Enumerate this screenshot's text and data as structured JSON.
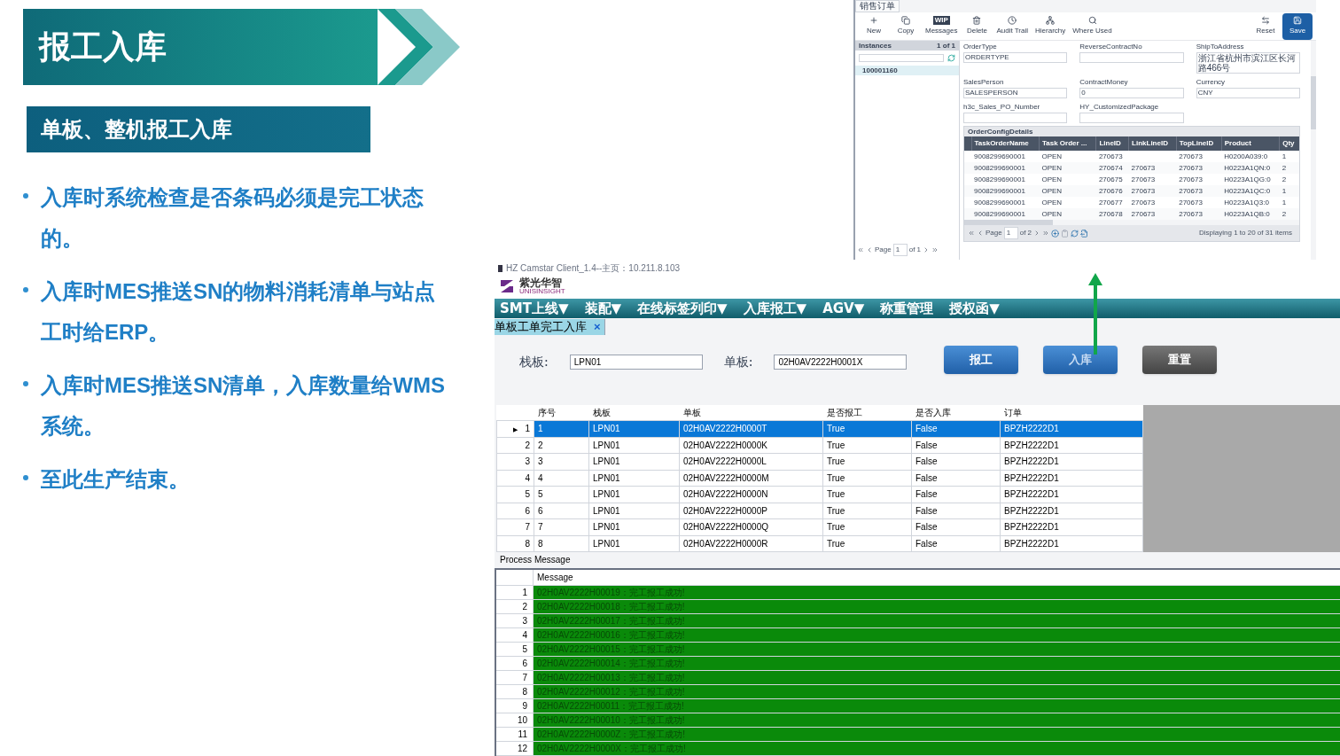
{
  "slide": {
    "title": "报工入库",
    "subtitle": "单板、整机报工入库",
    "bullets": [
      "入库时系统检查是否条码必须是完工状态的。",
      "入库时MES推送SN的物料消耗清单与站点工时给ERP。",
      "入库时MES推送SN清单，入库数量给WMS系统。",
      "至此生产结束。"
    ]
  },
  "sales_order_window": {
    "tab": "销售订单",
    "toolbar": [
      {
        "kind": "new",
        "label": "New"
      },
      {
        "kind": "copy",
        "label": "Copy"
      },
      {
        "kind": "wip",
        "label": "Messages",
        "badge": "WIP"
      },
      {
        "kind": "delete",
        "label": "Delete"
      },
      {
        "kind": "audit",
        "label": "Audit Trail"
      },
      {
        "kind": "hierarchy",
        "label": "Hierarchy"
      },
      {
        "kind": "where",
        "label": "Where Used"
      },
      {
        "kind": "reset",
        "label": "Reset"
      },
      {
        "kind": "save",
        "label": "Save"
      }
    ],
    "instances": {
      "title": "Instances",
      "count": "1 of 1",
      "items": [
        {
          "label": "100001160",
          "selected": true
        }
      ],
      "pager": {
        "page": "Page",
        "value": "1",
        "of": "of 1"
      }
    },
    "fields": [
      {
        "label": "OrderType",
        "value": "ORDERTYPE"
      },
      {
        "label": "ReverseContractNo"
      },
      {
        "label": "ShipToAddress",
        "value": "浙江省杭州市滨江区长河路466号"
      },
      {
        "label": "SalesPerson",
        "value": "SALESPERSON"
      },
      {
        "label": "ContractMoney",
        "value": "0"
      },
      {
        "label": "Currency",
        "value": "CNY"
      },
      {
        "label": "h3c_Sales_PO_Number"
      },
      {
        "label": "HY_CustomizedPackage"
      }
    ],
    "details": {
      "title": "OrderConfigDetails",
      "columns": [
        "TaskOrderName",
        "Task Order ...",
        "LineID",
        "LinkLineID",
        "TopLineID",
        "Product",
        "Qty"
      ],
      "rows": [
        [
          "9008299690001",
          "OPEN",
          "270673",
          "",
          "270673",
          "H0200A039:0",
          "1"
        ],
        [
          "9008299690001",
          "OPEN",
          "270674",
          "270673",
          "270673",
          "H0223A1QN:0",
          "2"
        ],
        [
          "9008299690001",
          "OPEN",
          "270675",
          "270673",
          "270673",
          "H0223A1QG:0",
          "2"
        ],
        [
          "9008299690001",
          "OPEN",
          "270676",
          "270673",
          "270673",
          "H0223A1QC:0",
          "1"
        ],
        [
          "9008299690001",
          "OPEN",
          "270677",
          "270673",
          "270673",
          "H0223A1Q3:0",
          "1"
        ],
        [
          "9008299690001",
          "OPEN",
          "270678",
          "270673",
          "270673",
          "H0223A1QB:0",
          "2"
        ]
      ],
      "pager": {
        "page": "Page",
        "value": "1",
        "of": "of 2",
        "status": "Displaying 1 to 20 of 31 items"
      }
    }
  },
  "client": {
    "title": "HZ Camstar Client_1.4--主页：10.211.8.103",
    "logo": {
      "name": "紫光华智",
      "sub": "UNISINSIGHT"
    },
    "menu": [
      "SMT上线▼",
      "装配▼",
      "在线标签列印▼",
      "入库报工▼",
      "AGV▼",
      "称重管理",
      "授权函▼"
    ],
    "tab": {
      "label": "单板工单完工入库",
      "close": "×"
    },
    "form": [
      {
        "label": "栈板:",
        "value": "LPN01"
      },
      {
        "label": "单板:",
        "value": "02H0AV2222H0001X"
      }
    ],
    "buttons": [
      {
        "kind": "primary",
        "label": "报工",
        "obscured": false
      },
      {
        "kind": "primary",
        "label": "入库",
        "obscured": true
      },
      {
        "kind": "secondary",
        "label": "重置",
        "obscured": false
      }
    ],
    "grid": {
      "current_marker": "▶",
      "columns": [
        "序号",
        "栈板",
        "单板",
        "是否报工",
        "是否入库",
        "订单"
      ],
      "rows": [
        {
          "num": "1",
          "selected": true,
          "cells": [
            "1",
            "LPN01",
            "02H0AV2222H0000T",
            "True",
            "False",
            "BPZH2222D1"
          ]
        },
        {
          "num": "2",
          "selected": false,
          "cells": [
            "2",
            "LPN01",
            "02H0AV2222H0000K",
            "True",
            "False",
            "BPZH2222D1"
          ]
        },
        {
          "num": "3",
          "selected": false,
          "cells": [
            "3",
            "LPN01",
            "02H0AV2222H0000L",
            "True",
            "False",
            "BPZH2222D1"
          ]
        },
        {
          "num": "4",
          "selected": false,
          "cells": [
            "4",
            "LPN01",
            "02H0AV2222H0000M",
            "True",
            "False",
            "BPZH2222D1"
          ]
        },
        {
          "num": "5",
          "selected": false,
          "cells": [
            "5",
            "LPN01",
            "02H0AV2222H0000N",
            "True",
            "False",
            "BPZH2222D1"
          ]
        },
        {
          "num": "6",
          "selected": false,
          "cells": [
            "6",
            "LPN01",
            "02H0AV2222H0000P",
            "True",
            "False",
            "BPZH2222D1"
          ]
        },
        {
          "num": "7",
          "selected": false,
          "cells": [
            "7",
            "LPN01",
            "02H0AV2222H0000Q",
            "True",
            "False",
            "BPZH2222D1"
          ]
        },
        {
          "num": "8",
          "selected": false,
          "cells": [
            "8",
            "LPN01",
            "02H0AV2222H0000R",
            "True",
            "False",
            "BPZH2222D1"
          ]
        }
      ]
    },
    "process": {
      "title": "Process Message",
      "column": "Message",
      "rows": [
        {
          "num": "1",
          "text": "02H0AV2222H00019：完工报工成功!"
        },
        {
          "num": "2",
          "text": "02H0AV2222H00018：完工报工成功!"
        },
        {
          "num": "3",
          "text": "02H0AV2222H00017：完工报工成功!"
        },
        {
          "num": "4",
          "text": "02H0AV2222H00016：完工报工成功!"
        },
        {
          "num": "5",
          "text": "02H0AV2222H00015：完工报工成功!"
        },
        {
          "num": "6",
          "text": "02H0AV2222H00014：完工报工成功!"
        },
        {
          "num": "7",
          "text": "02H0AV2222H00013：完工报工成功!"
        },
        {
          "num": "8",
          "text": "02H0AV2222H00012：完工报工成功!"
        },
        {
          "num": "9",
          "text": "02H0AV2222H00011：完工报工成功!"
        },
        {
          "num": "10",
          "text": "02H0AV2222H00010：完工报工成功!"
        },
        {
          "num": "11",
          "text": "02H0AV2222H0000Z：完工报工成功!"
        },
        {
          "num": "12",
          "text": "02H0AV2222H0000X：完工报工成功!"
        }
      ]
    }
  }
}
